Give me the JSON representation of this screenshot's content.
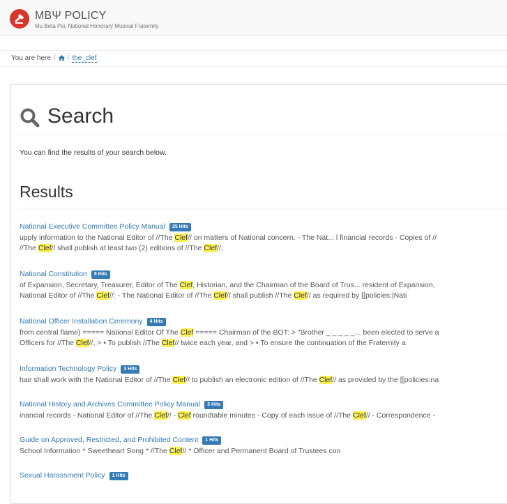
{
  "header": {
    "site_name": "MBΨ POLICY",
    "site_tagline": "Mu Beta Psi, National Honorary Musical Fraternity"
  },
  "breadcrumb": {
    "prefix": "You are here",
    "current": "the_clef"
  },
  "search": {
    "title": "Search",
    "intro": "You can find the results of your search below."
  },
  "results": {
    "heading": "Results",
    "items": [
      {
        "title": "National Executive Committee Policy Manual",
        "hits": "25 Hits",
        "lines": [
          [
            [
              "upply information to the National Editor of //The ",
              false
            ],
            [
              "Clef",
              true
            ],
            [
              "// on matters of National concern. - The Nat... l financial records - Copies of //",
              false
            ]
          ],
          [
            [
              "//The ",
              false
            ],
            [
              "Clef",
              true
            ],
            [
              "// shall publish at least two (2) editions of //The ",
              false
            ],
            [
              "Clef",
              true
            ],
            [
              "//,",
              false
            ]
          ]
        ]
      },
      {
        "title": "National Constitution",
        "hits": "9 Hits",
        "lines": [
          [
            [
              "of Expansion, Secretary, Treasurer, Editor of The ",
              false
            ],
            [
              "Clef",
              true
            ],
            [
              ", Historian, and the Chairman of the Board of Trus... resident of Expansion,",
              false
            ]
          ],
          [
            [
              "National Editor of //The ",
              false
            ],
            [
              "Clef",
              true
            ],
            [
              "//: - The National Editor of //The ",
              false
            ],
            [
              "Clef",
              true
            ],
            [
              "// shall publish //The ",
              false
            ],
            [
              "Clef",
              true
            ],
            [
              "// as required by [[policies:|Nati",
              false
            ]
          ]
        ]
      },
      {
        "title": "National Officer Installation Ceremony",
        "hits": "4 Hits",
        "lines": [
          [
            [
              "from central flame) ===== National Editor Of The ",
              false
            ],
            [
              "Clef",
              true
            ],
            [
              " ===== Chairman of the BOT: > \"Brother _ _ _ _ _... been elected to serve a",
              false
            ]
          ],
          [
            [
              "Officers for //The ",
              false
            ],
            [
              "Clef",
              true
            ],
            [
              "//, > • To publish //The ",
              false
            ],
            [
              "Clef",
              true
            ],
            [
              "// twice each year, and > • To ensure the continuation of the Fraternity a",
              false
            ]
          ]
        ]
      },
      {
        "title": "Information Technology Policy",
        "hits": "3 Hits",
        "lines": [
          [
            [
              "hair shall work with the National Editor of //The ",
              false
            ],
            [
              "Clef",
              true
            ],
            [
              "// to publish an electronic edition of //The ",
              false
            ],
            [
              "Clef",
              true
            ],
            [
              "// as provided by the [[policies:na",
              false
            ]
          ]
        ]
      },
      {
        "title": "National History and Archives Committee Policy Manual",
        "hits": "3 Hits",
        "lines": [
          [
            [
              "inancial records - National Editor of //The ",
              false
            ],
            [
              "Clef",
              true
            ],
            [
              "// - ",
              false
            ],
            [
              "Clef",
              true
            ],
            [
              " roundtable minutes - Copy of each issue of //The ",
              false
            ],
            [
              "Clef",
              true
            ],
            [
              "// - Correspondence -",
              false
            ]
          ]
        ]
      },
      {
        "title": "Guide on Approved, Restricted, and Prohibited Content",
        "hits": "1 Hits",
        "lines": [
          [
            [
              "School Information * Sweetheart Song * //The ",
              false
            ],
            [
              "Clef",
              true
            ],
            [
              "// * Officer and Permanent Board of Trustees con",
              false
            ]
          ]
        ]
      },
      {
        "title": "Sexual Harassment Policy",
        "hits": "1 Hits",
        "lines": []
      }
    ]
  },
  "colors": {
    "link": "#337ab7",
    "badge": "#337ab7",
    "highlight": "#fcf251",
    "logo": "#d9352b"
  }
}
